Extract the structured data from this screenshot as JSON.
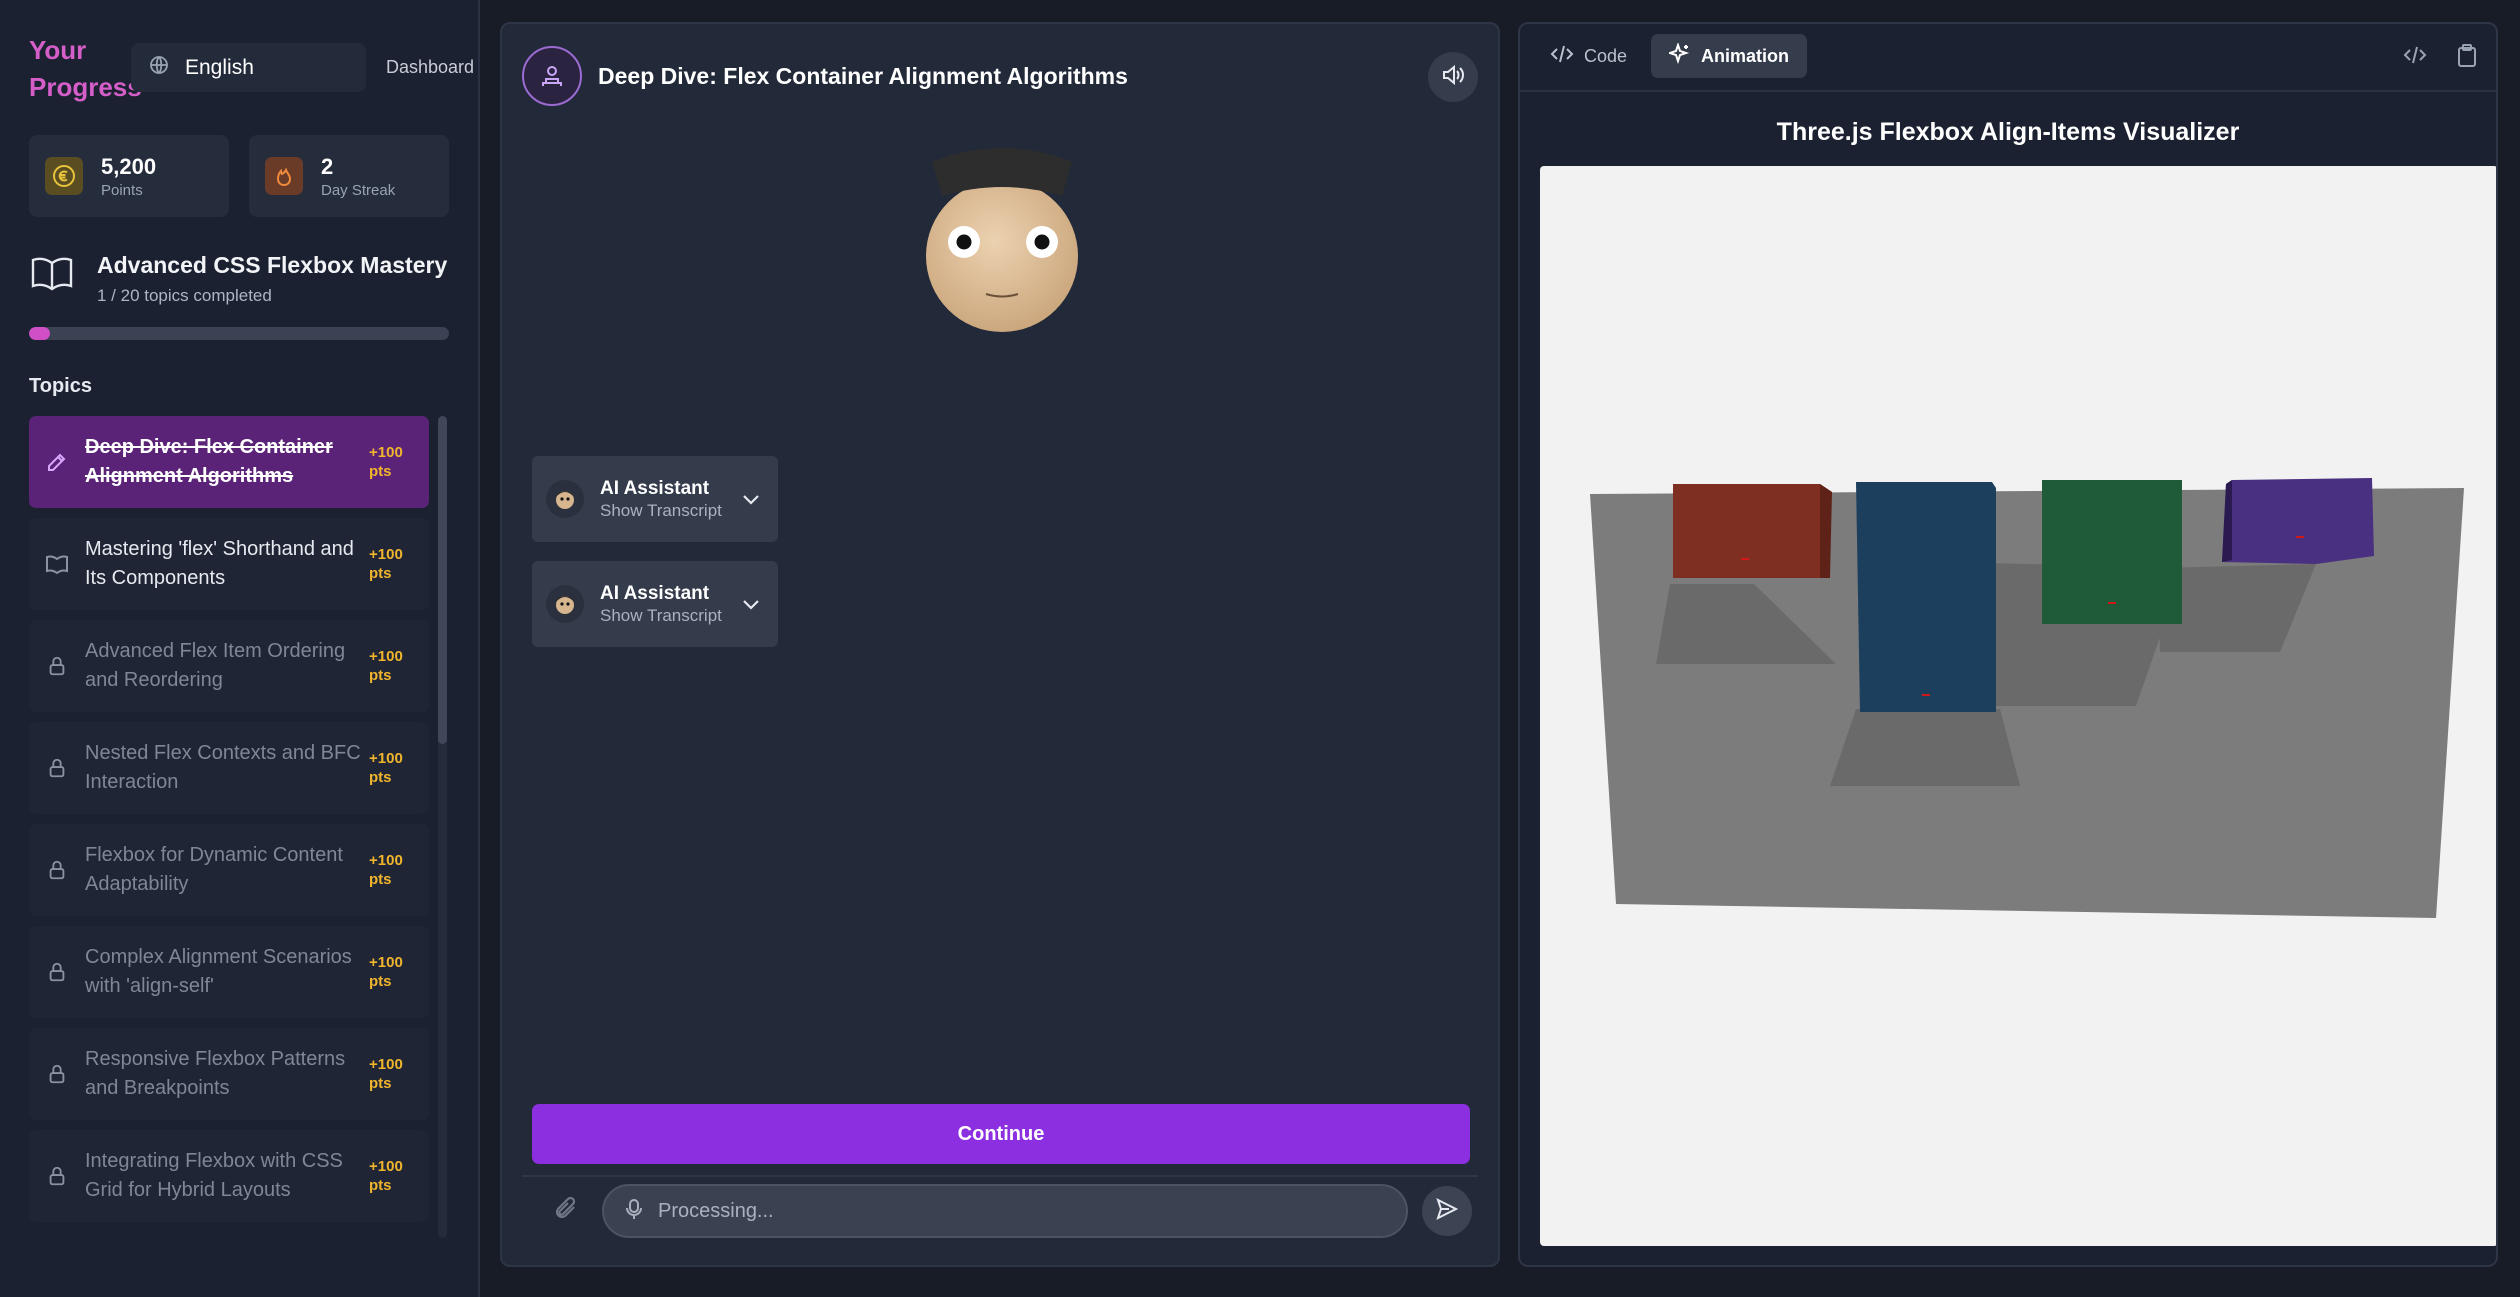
{
  "sidebar": {
    "brand": "Your Progress",
    "language": "English",
    "dashboard_link": "Dashboard",
    "points": {
      "value": "5,200",
      "label": "Points"
    },
    "streak": {
      "value": "2",
      "label": "Day Streak"
    },
    "course": {
      "title": "Advanced CSS Flexbox Mastery",
      "subtitle": "1 / 20 topics completed",
      "progress_fraction": 0.05
    },
    "topics_label": "Topics",
    "topics": [
      {
        "label": "Deep Dive: Flex Container Alignment Algorithms",
        "points": "+100 pts",
        "state": "active",
        "icon": "edit-icon"
      },
      {
        "label": "Mastering 'flex' Shorthand and Its Components",
        "points": "+100 pts",
        "state": "open",
        "icon": "book-icon"
      },
      {
        "label": "Advanced Flex Item Ordering and Reordering",
        "points": "+100 pts",
        "state": "locked",
        "icon": "lock-icon"
      },
      {
        "label": "Nested Flex Contexts and BFC Interaction",
        "points": "+100 pts",
        "state": "locked",
        "icon": "lock-icon"
      },
      {
        "label": "Flexbox for Dynamic Content Adaptability",
        "points": "+100 pts",
        "state": "locked",
        "icon": "lock-icon"
      },
      {
        "label": "Complex Alignment Scenarios with 'align-self'",
        "points": "+100 pts",
        "state": "locked",
        "icon": "lock-icon"
      },
      {
        "label": "Responsive Flexbox Patterns and Breakpoints",
        "points": "+100 pts",
        "state": "locked",
        "icon": "lock-icon"
      },
      {
        "label": "Integrating Flexbox with CSS Grid for Hybrid Layouts",
        "points": "+100 pts",
        "state": "locked",
        "icon": "lock-icon"
      }
    ]
  },
  "chat": {
    "title": "Deep Dive: Flex Container Alignment Algorithms",
    "messages": [
      {
        "name": "AI Assistant",
        "action": "Show Transcript"
      },
      {
        "name": "AI Assistant",
        "action": "Show Transcript"
      }
    ],
    "continue_label": "Continue",
    "input_placeholder": "Processing..."
  },
  "viz": {
    "tabs": [
      {
        "label": "Code",
        "icon": "code-icon",
        "active": false
      },
      {
        "label": "Animation",
        "icon": "sparkle-icon",
        "active": true
      }
    ],
    "title": "Three.js Flexbox Align-Items Visualizer",
    "boxes": [
      {
        "color": "#7f2f22"
      },
      {
        "color": "#1d3f5e"
      },
      {
        "color": "#1f5a39"
      },
      {
        "color": "#4a3080"
      }
    ]
  },
  "colors": {
    "accent_purple": "#8b2fe0",
    "brand_pink": "#d55ec9",
    "points_gold": "#f0b52d"
  }
}
